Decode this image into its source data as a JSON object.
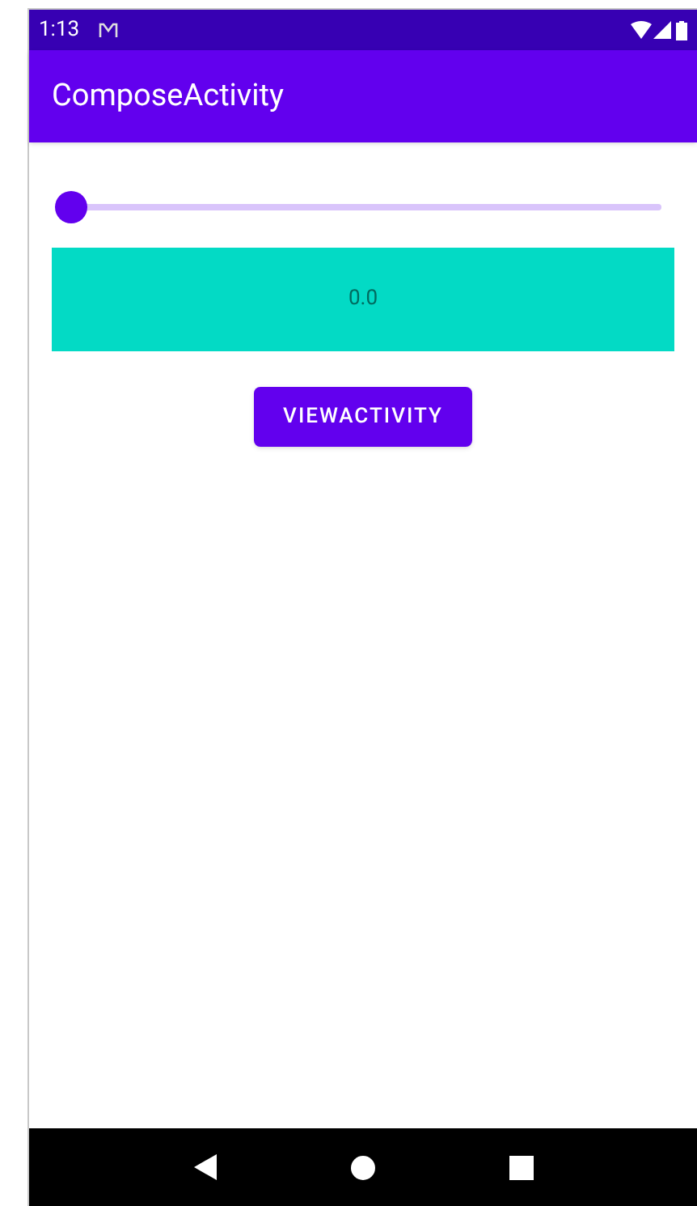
{
  "status_bar": {
    "time": "1:13"
  },
  "app_bar": {
    "title": "ComposeActivity"
  },
  "slider": {
    "level": 0
  },
  "value_box": {
    "text": "0.0"
  },
  "button": {
    "label": "VIEWACTIVITY"
  }
}
